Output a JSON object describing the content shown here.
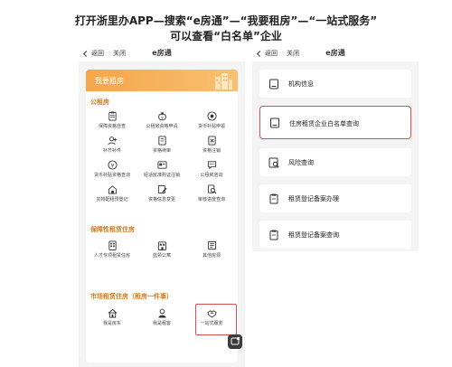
{
  "caption": {
    "line1": "打开浙里办APP—搜索“e房通”—“我要租房”—“一站式服务”",
    "line2": "可以查看“白名单”企业"
  },
  "left": {
    "nav": {
      "back": "返回",
      "close": "关闭",
      "title": "e房通"
    },
    "banner_title": "我要租房",
    "sections": [
      {
        "title": "公租房",
        "items": [
          {
            "label": "保障资格自查",
            "icon": "clipboard-icon"
          },
          {
            "label": "公租房资格申请",
            "icon": "money-bag-icon"
          },
          {
            "label": "货币补贴申领",
            "icon": "target-icon"
          },
          {
            "label": "补齐补件",
            "icon": "user-add-icon"
          },
          {
            "label": "资格续审",
            "icon": "document-icon"
          },
          {
            "label": "资格注销",
            "icon": "document-cancel-icon"
          },
          {
            "label": "货币补贴资格查询",
            "icon": "yuan-coin-icon"
          },
          {
            "label": "经适房准购证注销",
            "icon": "card-icon"
          },
          {
            "label": "公租房咨询",
            "icon": "chat-icon"
          },
          {
            "label": "实物配租预登记",
            "icon": "home-key-icon"
          },
          {
            "label": "资格信息变更",
            "icon": "edit-icon"
          },
          {
            "label": "审核进度查询",
            "icon": "search-icon"
          }
        ]
      },
      {
        "title": "保障性租赁住房",
        "items": [
          {
            "label": "人才专项租赁住房",
            "icon": "building-icon"
          },
          {
            "label": "蓝领公寓",
            "icon": "apartment-icon"
          },
          {
            "label": "其他房源",
            "icon": "house-list-icon"
          }
        ]
      },
      {
        "title": "市场租赁住房（租房一件事）",
        "items": [
          {
            "label": "我是房东",
            "icon": "house-icon"
          },
          {
            "label": "我是租客",
            "icon": "person-icon"
          },
          {
            "label": "一站式服务",
            "icon": "handshake-icon"
          }
        ]
      }
    ]
  },
  "right": {
    "nav": {
      "back": "返回",
      "close": "关闭",
      "title": "e房通"
    },
    "items": [
      {
        "label": "机构信息",
        "icon": "document-icon"
      },
      {
        "label": "住房租赁企业白名单查询",
        "icon": "document-icon"
      },
      {
        "label": "风险查询",
        "icon": "magnifier-doc-icon"
      },
      {
        "label": "租赁登记备案办理",
        "icon": "register-doc-icon"
      },
      {
        "label": "租赁登记备案查询",
        "icon": "register-doc-icon"
      }
    ]
  },
  "colors": {
    "accent": "#f6a54a",
    "section_title": "#d47a1e",
    "highlight": "#d94f4f"
  }
}
